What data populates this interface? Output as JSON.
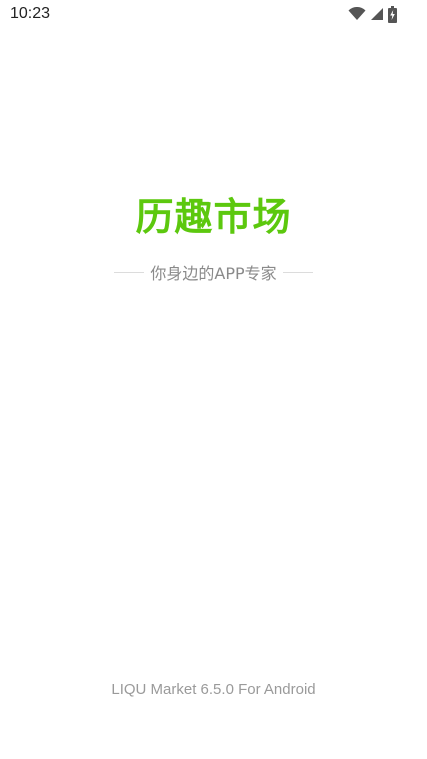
{
  "status_bar": {
    "time": "10:23",
    "icons": [
      "wifi-icon",
      "signal-icon",
      "battery-charging-icon"
    ]
  },
  "splash": {
    "title": "历趣市场",
    "tagline": "你身边的APP专家",
    "footer": "LIQU Market 6.5.0 For Android"
  },
  "colors": {
    "brand": "#5cc80e",
    "tagline": "#8a8a8a",
    "footer": "#9a9a9a",
    "background": "#ffffff"
  }
}
